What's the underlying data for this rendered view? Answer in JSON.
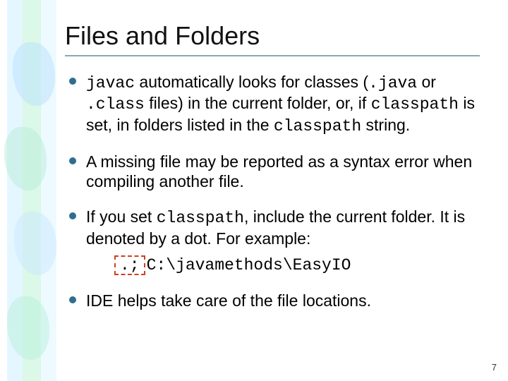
{
  "title": "Files and Folders",
  "bullets": {
    "b1": {
      "t1": "javac",
      "t2": " automatically looks for classes (",
      "t3": ".java",
      "t4": " or ",
      "t5": ".class",
      "t6": " files) in the current folder, or, if ",
      "t7": "classpath",
      "t8": " is set, in folders listed in the ",
      "t9": "classpath",
      "t10": " string."
    },
    "b2": "A missing file may be reported as a syntax error when compiling another file.",
    "b3": {
      "t1": "If you set ",
      "t2": "classpath",
      "t3": ", include the current folder. It is denoted by a dot. For example:"
    },
    "example": {
      "dot": ".;",
      "path": "C:\\javamethods\\EasyIO"
    },
    "b4": "IDE helps take care of the file locations."
  },
  "page_number": "7"
}
